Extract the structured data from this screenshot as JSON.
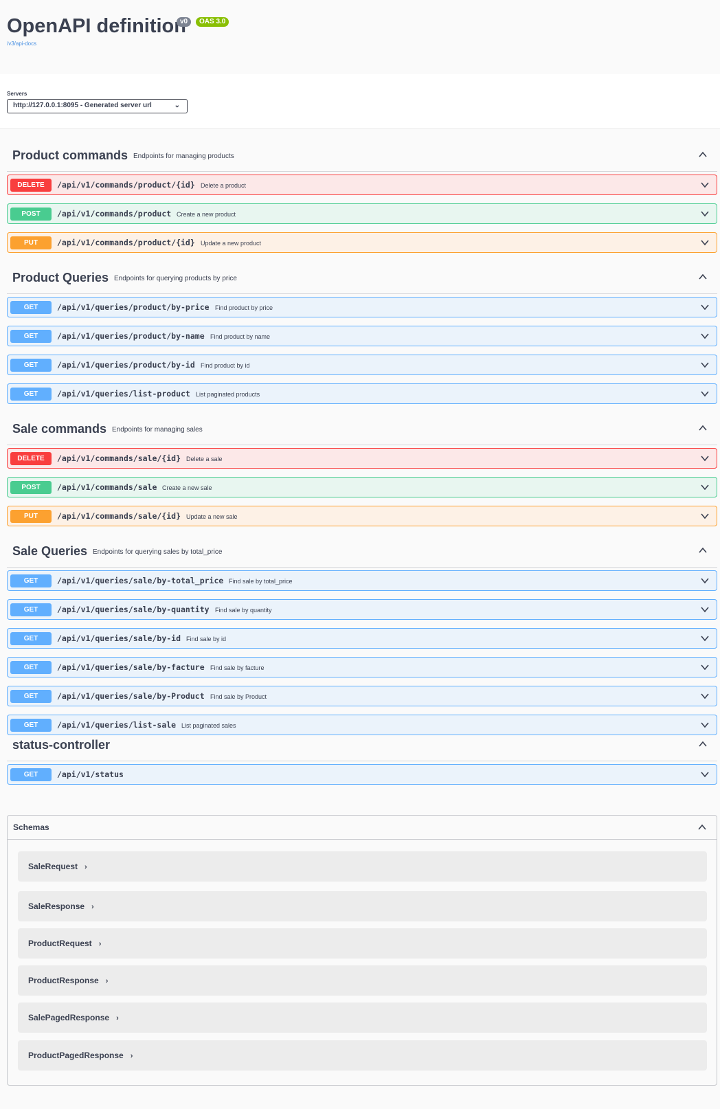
{
  "info": {
    "title": "OpenAPI definition",
    "version": "v0",
    "oas": "OAS 3.0",
    "spec_link": "/v3/api-docs"
  },
  "servers": {
    "label": "Servers",
    "selected": "http://127.0.0.1:8095 - Generated server url"
  },
  "tags": [
    {
      "name": "Product commands",
      "description": "Endpoints for managing products",
      "operations": [
        {
          "method": "DELETE",
          "path": "/api/v1/commands/product/{id}",
          "summary": "Delete a product"
        },
        {
          "method": "POST",
          "path": "/api/v1/commands/product",
          "summary": "Create a new product"
        },
        {
          "method": "PUT",
          "path": "/api/v1/commands/product/{id}",
          "summary": "Update a new product"
        }
      ]
    },
    {
      "name": "Product Queries",
      "description": "Endpoints for querying products by price",
      "operations": [
        {
          "method": "GET",
          "path": "/api/v1/queries/product/by-price",
          "summary": "Find product by price"
        },
        {
          "method": "GET",
          "path": "/api/v1/queries/product/by-name",
          "summary": "Find product by name"
        },
        {
          "method": "GET",
          "path": "/api/v1/queries/product/by-id",
          "summary": "Find product by id"
        },
        {
          "method": "GET",
          "path": "/api/v1/queries/list-product",
          "summary": "List paginated products"
        }
      ]
    },
    {
      "name": "Sale commands",
      "description": "Endpoints for managing sales",
      "operations": [
        {
          "method": "DELETE",
          "path": "/api/v1/commands/sale/{id}",
          "summary": "Delete a sale"
        },
        {
          "method": "POST",
          "path": "/api/v1/commands/sale",
          "summary": "Create a new sale"
        },
        {
          "method": "PUT",
          "path": "/api/v1/commands/sale/{id}",
          "summary": "Update a new sale"
        }
      ]
    },
    {
      "name": "Sale Queries",
      "description": "Endpoints for querying sales by total_price",
      "operations": [
        {
          "method": "GET",
          "path": "/api/v1/queries/sale/by-total_price",
          "summary": "Find sale by total_price"
        },
        {
          "method": "GET",
          "path": "/api/v1/queries/sale/by-quantity",
          "summary": "Find sale by quantity"
        },
        {
          "method": "GET",
          "path": "/api/v1/queries/sale/by-id",
          "summary": "Find sale by id"
        },
        {
          "method": "GET",
          "path": "/api/v1/queries/sale/by-facture",
          "summary": "Find sale by facture"
        },
        {
          "method": "GET",
          "path": "/api/v1/queries/sale/by-Product",
          "summary": "Find sale by Product"
        },
        {
          "method": "GET",
          "path": "/api/v1/queries/list-sale",
          "summary": "List paginated sales"
        }
      ]
    },
    {
      "name": "status-controller",
      "description": "",
      "operations": [
        {
          "method": "GET",
          "path": "/api/v1/status",
          "summary": ""
        }
      ]
    }
  ],
  "schemas": {
    "title": "Schemas",
    "items": [
      "SaleRequest",
      "SaleResponse",
      "ProductRequest",
      "ProductResponse",
      "SalePagedResponse",
      "ProductPagedResponse"
    ]
  },
  "colors": {
    "delete": "#f93e3e",
    "post": "#49cc90",
    "put": "#fca130",
    "get": "#61affe",
    "oas_badge": "#89bf04",
    "version_badge": "#7d8492"
  },
  "icons": {
    "expand": "chevron-down-icon",
    "collapse": "chevron-up-icon",
    "model_expand": "chevron-right-icon"
  }
}
